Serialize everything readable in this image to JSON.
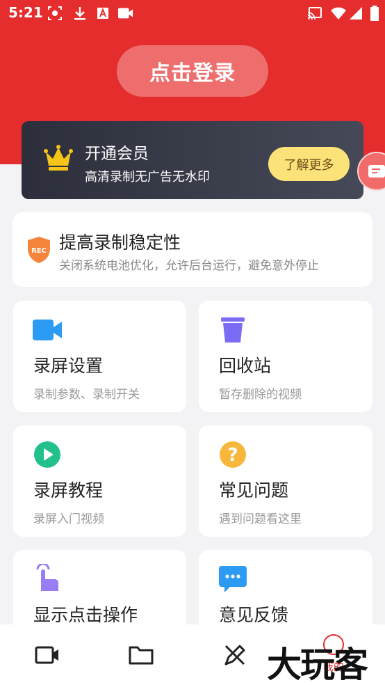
{
  "status_bar": {
    "time": "5:21",
    "left_icons": [
      "screen-record-icon",
      "download-icon",
      "font-icon",
      "video-camera-icon"
    ],
    "right_icons": [
      "cast-icon",
      "wifi-icon",
      "signal-icon",
      "battery-icon"
    ]
  },
  "header": {
    "login_label": "点击登录",
    "accent_color": "#e62d2d"
  },
  "vip": {
    "title": "开通会员",
    "subtitle": "高清录制无广告无水印",
    "more_label": "了解更多"
  },
  "stability": {
    "badge_text": "REC",
    "title": "提高录制稳定性",
    "subtitle": "关闭系统电池优化，允许后台运行，避免意外停止"
  },
  "grid": [
    {
      "icon": "video-camera-icon",
      "title": "录屏设置",
      "subtitle": "录制参数、录制开关"
    },
    {
      "icon": "trash-icon",
      "title": "回收站",
      "subtitle": "暂存删除的视频"
    },
    {
      "icon": "play-icon",
      "title": "录屏教程",
      "subtitle": "录屏入门视频"
    },
    {
      "icon": "question-icon",
      "title": "常见问题",
      "subtitle": "遇到问题看这里"
    },
    {
      "icon": "tap-hand-icon",
      "title": "显示点击操作",
      "subtitle": ""
    },
    {
      "icon": "chat-bubble-icon",
      "title": "意见反馈",
      "subtitle": ""
    }
  ],
  "bottom_nav": {
    "items": [
      "video-tab-icon",
      "folder-tab-icon",
      "edit-tab-icon"
    ],
    "mine_label": "我的"
  },
  "watermark": "大玩客"
}
